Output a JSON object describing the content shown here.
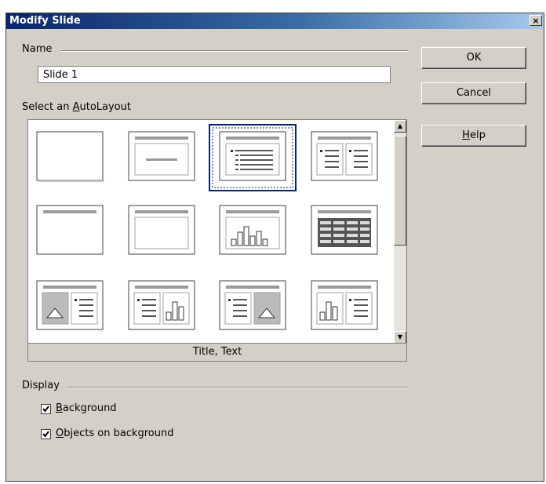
{
  "dialog": {
    "title": "Modify Slide",
    "close_symbol": "×"
  },
  "name_group": {
    "label": "Name",
    "value": "Slide 1"
  },
  "layout_group": {
    "label_prefix": "Select an ",
    "label_accel": "A",
    "label_suffix": "utoLayout",
    "selected_caption": "Title, Text",
    "layouts": [
      {
        "icon": "blank-slide-icon"
      },
      {
        "icon": "title-only-slide-icon"
      },
      {
        "icon": "title-text-slide-icon"
      },
      {
        "icon": "title-two-column-text-icon"
      },
      {
        "icon": "title-blank-slide-icon"
      },
      {
        "icon": "title-content-slide-icon"
      },
      {
        "icon": "title-chart-slide-icon"
      },
      {
        "icon": "title-table-slide-icon"
      },
      {
        "icon": "title-image-text-icon"
      },
      {
        "icon": "title-text-chart-icon"
      },
      {
        "icon": "title-text-image-icon"
      },
      {
        "icon": "title-chart-text-icon"
      }
    ],
    "selected_index": 2
  },
  "buttons": {
    "ok": "OK",
    "cancel": "Cancel",
    "help_accel": "H",
    "help_rest": "elp"
  },
  "display_group": {
    "label": "Display",
    "background": {
      "accel": "B",
      "rest": "ackground",
      "checked": true
    },
    "objects": {
      "accel": "O",
      "rest": "bjects on background",
      "checked": true
    }
  }
}
